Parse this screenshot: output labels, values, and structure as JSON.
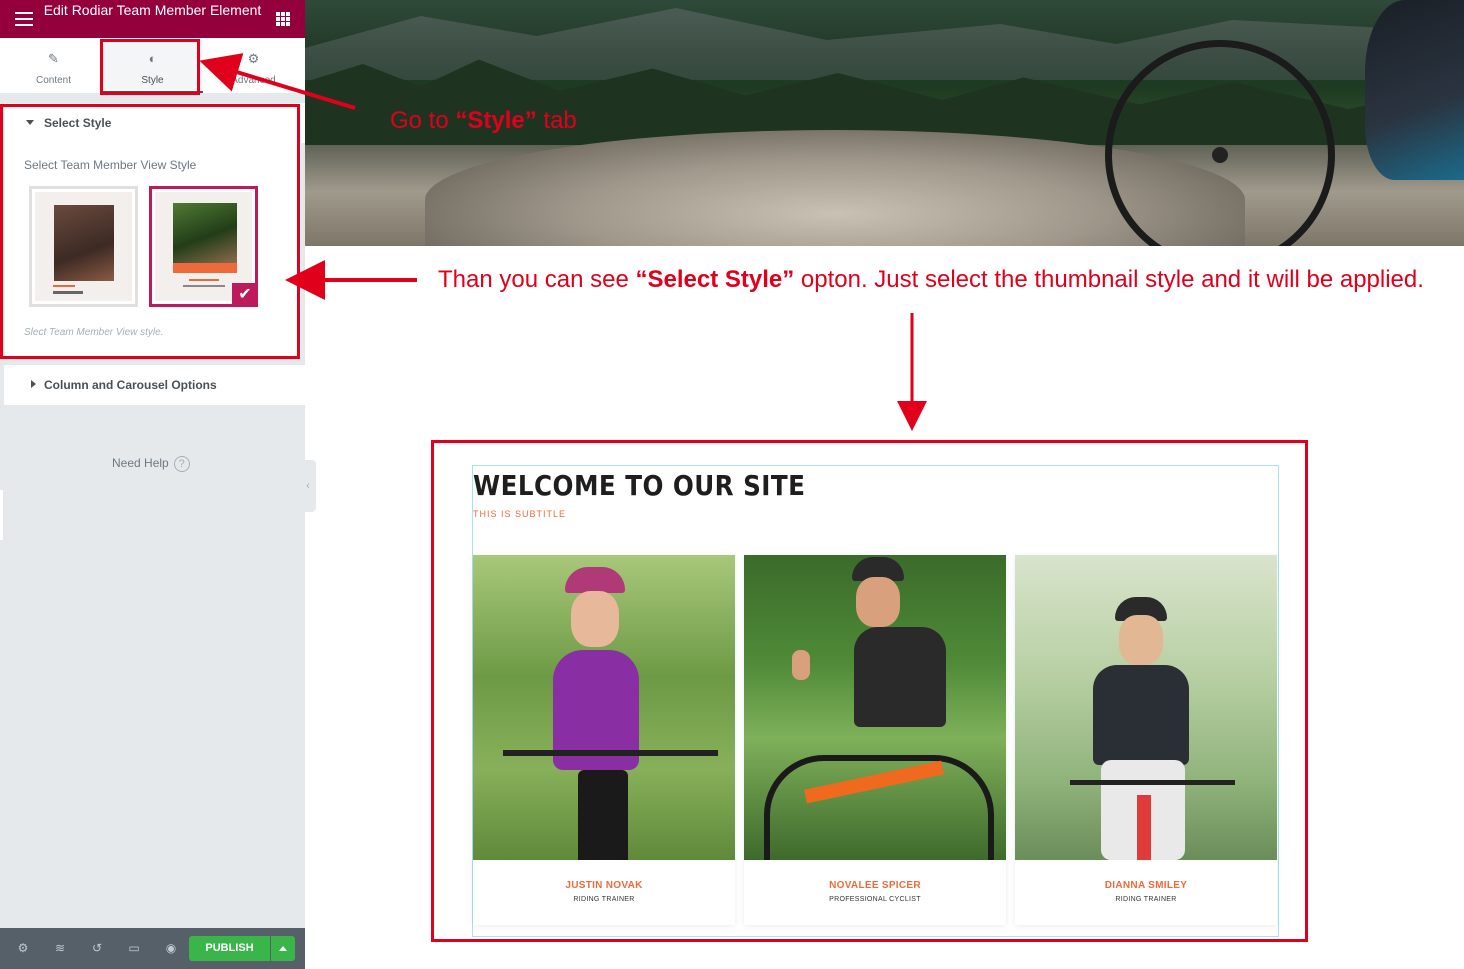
{
  "sidebar": {
    "header_title": "Edit Rodiar Team Member Element",
    "tabs": [
      {
        "label": "Content",
        "icon": "pencil-icon"
      },
      {
        "label": "Style",
        "icon": "half-circle-icon"
      },
      {
        "label": "Advanced",
        "icon": "gear-icon"
      }
    ],
    "active_tab": "Style",
    "sections": [
      {
        "title": "Select Style",
        "expanded": true,
        "control_label": "Select Team Member View Style",
        "options": [
          "style-1",
          "style-2"
        ],
        "selected_option": "style-2",
        "hint": "Slect Team Member View style."
      },
      {
        "title": "Column and Carousel Options",
        "expanded": false
      }
    ],
    "need_help": "Need Help",
    "footer": {
      "icons": [
        "settings-icon",
        "layers-icon",
        "history-icon",
        "responsive-icon",
        "eye-icon"
      ],
      "publish_label": "PUBLISH"
    }
  },
  "annotations": {
    "go_to_style": {
      "pre": "Go  to ",
      "bold": "“Style”",
      "post": " tab"
    },
    "select_style": {
      "pre": "Than you  can see ",
      "bold": "“Select Style”",
      "post": " opton. Just select the thumbnail style and it will be applied."
    },
    "color": "#e0001b"
  },
  "preview": {
    "title": "WELCOME TO OUR SITE",
    "subtitle": "THIS IS SUBTITLE",
    "members": [
      {
        "name": "JUSTIN NOVAK",
        "role": "RIDING TRAINER"
      },
      {
        "name": "NOVALEE SPICER",
        "role": "PROFESSIONAL CYCLIST"
      },
      {
        "name": "DIANNA SMILEY",
        "role": "RIDING TRAINER"
      }
    ]
  },
  "colors": {
    "header": "#93003c",
    "accent": "#ef6a3a",
    "selected_border": "#bc1a5d",
    "publish": "#39b54a",
    "annotation": "#e0001b"
  }
}
